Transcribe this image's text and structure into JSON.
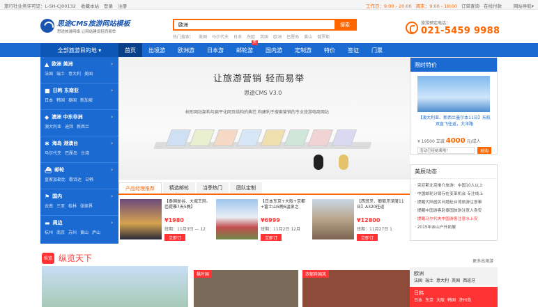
{
  "topbar": {
    "license": "旅行社业务许可证：L-SH-CJ00132",
    "bookmark": "收藏本站",
    "login": "登录",
    "register": "注册",
    "workday": "工作日：9:00 - 20:00",
    "weekend": "周末：9:00 - 18:00",
    "order_query": "订单查询",
    "online_pay": "在线付款",
    "nav_site": "网站导航▾"
  },
  "header": {
    "logo_title": "思途CMS旅游网站模板",
    "logo_sub": "思途旅游网络 让网站建设轻而易举",
    "search_value": "欧洲",
    "search_btn": "搜索",
    "hot_label": "热门搜索：",
    "hot_words": [
      "美国",
      "马尔代夫",
      "日本",
      "东欧",
      "英国",
      "欧洲",
      "巴厘岛",
      "黄山",
      "俄罗斯"
    ],
    "phone_label": "旅游预定电话：",
    "phone": "021-5459 9988"
  },
  "nav": {
    "all_dest": "全部旅游目的地 ▾",
    "items": [
      "首页",
      "出境游",
      "欧洲游",
      "日本游",
      "邮轮游",
      "国内游",
      "定制游",
      "特价",
      "签证",
      "门票"
    ],
    "hot_tag": "热"
  },
  "leftmenu": [
    {
      "title": "欧洲  美洲",
      "subs": [
        "法国",
        "瑞士",
        "意大利",
        "美国"
      ]
    },
    {
      "title": "日韩  东南亚",
      "subs": [
        "日本",
        "韩国",
        "泰国",
        "新加坡"
      ]
    },
    {
      "title": "澳洲  中东非洲",
      "subs": [
        "澳大利亚",
        "迪拜",
        "新西兰"
      ]
    },
    {
      "title": "海岛  港澳台",
      "subs": [
        "马尔代夫",
        "巴厘岛",
        "台湾"
      ]
    },
    {
      "title": "邮轮",
      "subs": [
        "皇家加勒比",
        "歌诗达",
        "日韩"
      ]
    },
    {
      "title": "国内",
      "subs": [
        "云南",
        "三亚",
        "桂林",
        "张家界"
      ]
    },
    {
      "title": "周边",
      "subs": [
        "杭州",
        "南京",
        "苏州",
        "黄山",
        "庐山"
      ]
    }
  ],
  "banner": {
    "headline": "让旅游营销  轻而易举",
    "product": "思途CMS V3.0",
    "desc": "树形网站架构与扁平化网页结构的典范   构建利于搜索营销的专业旅游电商网站"
  },
  "product_tabs": [
    "产品经理推荐",
    "精选邮轮",
    "当季热门",
    "团队定制"
  ],
  "products": [
    {
      "name": "【泰国曼谷、大城王府、芭提雅7天5晚】",
      "price": "¥1980",
      "date": "班期：11月3日 — 12",
      "book": "立即订"
    },
    {
      "name": "【日本东京+大阪+京都+富士山5晚6温泉之",
      "price": "¥6999",
      "date": "班期：11月2日  12月",
      "book": "立即订"
    },
    {
      "name": "【西班牙、葡萄牙深度11日】A320往返",
      "price": "¥12800",
      "date": "班期：11月27日  1",
      "book": "立即订"
    }
  ],
  "special": {
    "title": "限时特价",
    "caption": "【澳大利亚、新西兰墨尔本11日】东航双直飞往返，大洋路",
    "price_old": "¥ 19500 立减",
    "price_cut": "4000",
    "unit": "元/成人",
    "countdown": "活动已经结束啦！",
    "book": "抢购"
  },
  "news": {
    "title": "美辰动态",
    "items": [
      "突尼斯北京推介旅游：中国10人以上",
      "中国邮轮分销存在变革机会 专注线上",
      "提醒大陆居民问题赴台湾旅游注意事",
      "提醒中国游客赴泰国旅游注意人身安",
      "提醒马尔代夫中国游客注意水上安",
      "2015年余山户外拓展"
    ],
    "highlight_index": 4
  },
  "overview": {
    "badge": "纵览",
    "title": "纵览天下",
    "more": "更多出境游",
    "pic2_label": "枫叶国",
    "pic3_label": "浓郁异国风"
  },
  "dest_groups": [
    {
      "title": "欧洲",
      "items": [
        "法国",
        "瑞士",
        "意大利",
        "英国",
        "西班牙"
      ]
    },
    {
      "title": "日韩",
      "items": [
        "日本",
        "东京",
        "大阪",
        "韩国",
        "济州岛"
      ]
    }
  ]
}
